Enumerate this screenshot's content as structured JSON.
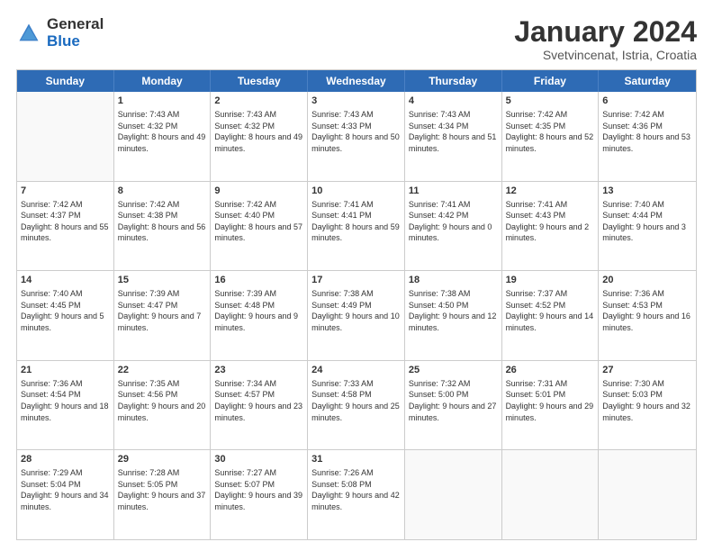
{
  "logo": {
    "general": "General",
    "blue": "Blue"
  },
  "title": "January 2024",
  "location": "Svetvincenat, Istria, Croatia",
  "days": [
    "Sunday",
    "Monday",
    "Tuesday",
    "Wednesday",
    "Thursday",
    "Friday",
    "Saturday"
  ],
  "weeks": [
    [
      {
        "day": "",
        "sunrise": "",
        "sunset": "",
        "daylight": "",
        "empty": true
      },
      {
        "day": "1",
        "sunrise": "Sunrise: 7:43 AM",
        "sunset": "Sunset: 4:32 PM",
        "daylight": "Daylight: 8 hours and 49 minutes.",
        "empty": false
      },
      {
        "day": "2",
        "sunrise": "Sunrise: 7:43 AM",
        "sunset": "Sunset: 4:32 PM",
        "daylight": "Daylight: 8 hours and 49 minutes.",
        "empty": false
      },
      {
        "day": "3",
        "sunrise": "Sunrise: 7:43 AM",
        "sunset": "Sunset: 4:33 PM",
        "daylight": "Daylight: 8 hours and 50 minutes.",
        "empty": false
      },
      {
        "day": "4",
        "sunrise": "Sunrise: 7:43 AM",
        "sunset": "Sunset: 4:34 PM",
        "daylight": "Daylight: 8 hours and 51 minutes.",
        "empty": false
      },
      {
        "day": "5",
        "sunrise": "Sunrise: 7:42 AM",
        "sunset": "Sunset: 4:35 PM",
        "daylight": "Daylight: 8 hours and 52 minutes.",
        "empty": false
      },
      {
        "day": "6",
        "sunrise": "Sunrise: 7:42 AM",
        "sunset": "Sunset: 4:36 PM",
        "daylight": "Daylight: 8 hours and 53 minutes.",
        "empty": false
      }
    ],
    [
      {
        "day": "7",
        "sunrise": "Sunrise: 7:42 AM",
        "sunset": "Sunset: 4:37 PM",
        "daylight": "Daylight: 8 hours and 55 minutes.",
        "empty": false
      },
      {
        "day": "8",
        "sunrise": "Sunrise: 7:42 AM",
        "sunset": "Sunset: 4:38 PM",
        "daylight": "Daylight: 8 hours and 56 minutes.",
        "empty": false
      },
      {
        "day": "9",
        "sunrise": "Sunrise: 7:42 AM",
        "sunset": "Sunset: 4:40 PM",
        "daylight": "Daylight: 8 hours and 57 minutes.",
        "empty": false
      },
      {
        "day": "10",
        "sunrise": "Sunrise: 7:41 AM",
        "sunset": "Sunset: 4:41 PM",
        "daylight": "Daylight: 8 hours and 59 minutes.",
        "empty": false
      },
      {
        "day": "11",
        "sunrise": "Sunrise: 7:41 AM",
        "sunset": "Sunset: 4:42 PM",
        "daylight": "Daylight: 9 hours and 0 minutes.",
        "empty": false
      },
      {
        "day": "12",
        "sunrise": "Sunrise: 7:41 AM",
        "sunset": "Sunset: 4:43 PM",
        "daylight": "Daylight: 9 hours and 2 minutes.",
        "empty": false
      },
      {
        "day": "13",
        "sunrise": "Sunrise: 7:40 AM",
        "sunset": "Sunset: 4:44 PM",
        "daylight": "Daylight: 9 hours and 3 minutes.",
        "empty": false
      }
    ],
    [
      {
        "day": "14",
        "sunrise": "Sunrise: 7:40 AM",
        "sunset": "Sunset: 4:45 PM",
        "daylight": "Daylight: 9 hours and 5 minutes.",
        "empty": false
      },
      {
        "day": "15",
        "sunrise": "Sunrise: 7:39 AM",
        "sunset": "Sunset: 4:47 PM",
        "daylight": "Daylight: 9 hours and 7 minutes.",
        "empty": false
      },
      {
        "day": "16",
        "sunrise": "Sunrise: 7:39 AM",
        "sunset": "Sunset: 4:48 PM",
        "daylight": "Daylight: 9 hours and 9 minutes.",
        "empty": false
      },
      {
        "day": "17",
        "sunrise": "Sunrise: 7:38 AM",
        "sunset": "Sunset: 4:49 PM",
        "daylight": "Daylight: 9 hours and 10 minutes.",
        "empty": false
      },
      {
        "day": "18",
        "sunrise": "Sunrise: 7:38 AM",
        "sunset": "Sunset: 4:50 PM",
        "daylight": "Daylight: 9 hours and 12 minutes.",
        "empty": false
      },
      {
        "day": "19",
        "sunrise": "Sunrise: 7:37 AM",
        "sunset": "Sunset: 4:52 PM",
        "daylight": "Daylight: 9 hours and 14 minutes.",
        "empty": false
      },
      {
        "day": "20",
        "sunrise": "Sunrise: 7:36 AM",
        "sunset": "Sunset: 4:53 PM",
        "daylight": "Daylight: 9 hours and 16 minutes.",
        "empty": false
      }
    ],
    [
      {
        "day": "21",
        "sunrise": "Sunrise: 7:36 AM",
        "sunset": "Sunset: 4:54 PM",
        "daylight": "Daylight: 9 hours and 18 minutes.",
        "empty": false
      },
      {
        "day": "22",
        "sunrise": "Sunrise: 7:35 AM",
        "sunset": "Sunset: 4:56 PM",
        "daylight": "Daylight: 9 hours and 20 minutes.",
        "empty": false
      },
      {
        "day": "23",
        "sunrise": "Sunrise: 7:34 AM",
        "sunset": "Sunset: 4:57 PM",
        "daylight": "Daylight: 9 hours and 23 minutes.",
        "empty": false
      },
      {
        "day": "24",
        "sunrise": "Sunrise: 7:33 AM",
        "sunset": "Sunset: 4:58 PM",
        "daylight": "Daylight: 9 hours and 25 minutes.",
        "empty": false
      },
      {
        "day": "25",
        "sunrise": "Sunrise: 7:32 AM",
        "sunset": "Sunset: 5:00 PM",
        "daylight": "Daylight: 9 hours and 27 minutes.",
        "empty": false
      },
      {
        "day": "26",
        "sunrise": "Sunrise: 7:31 AM",
        "sunset": "Sunset: 5:01 PM",
        "daylight": "Daylight: 9 hours and 29 minutes.",
        "empty": false
      },
      {
        "day": "27",
        "sunrise": "Sunrise: 7:30 AM",
        "sunset": "Sunset: 5:03 PM",
        "daylight": "Daylight: 9 hours and 32 minutes.",
        "empty": false
      }
    ],
    [
      {
        "day": "28",
        "sunrise": "Sunrise: 7:29 AM",
        "sunset": "Sunset: 5:04 PM",
        "daylight": "Daylight: 9 hours and 34 minutes.",
        "empty": false
      },
      {
        "day": "29",
        "sunrise": "Sunrise: 7:28 AM",
        "sunset": "Sunset: 5:05 PM",
        "daylight": "Daylight: 9 hours and 37 minutes.",
        "empty": false
      },
      {
        "day": "30",
        "sunrise": "Sunrise: 7:27 AM",
        "sunset": "Sunset: 5:07 PM",
        "daylight": "Daylight: 9 hours and 39 minutes.",
        "empty": false
      },
      {
        "day": "31",
        "sunrise": "Sunrise: 7:26 AM",
        "sunset": "Sunset: 5:08 PM",
        "daylight": "Daylight: 9 hours and 42 minutes.",
        "empty": false
      },
      {
        "day": "",
        "sunrise": "",
        "sunset": "",
        "daylight": "",
        "empty": true
      },
      {
        "day": "",
        "sunrise": "",
        "sunset": "",
        "daylight": "",
        "empty": true
      },
      {
        "day": "",
        "sunrise": "",
        "sunset": "",
        "daylight": "",
        "empty": true
      }
    ]
  ]
}
